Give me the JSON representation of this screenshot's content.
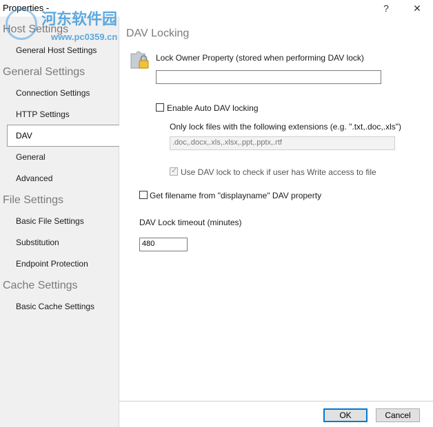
{
  "window": {
    "title": "Properties -",
    "help_glyph": "?",
    "close_glyph": "✕"
  },
  "watermark": {
    "cn": "河东软件园",
    "url": "www.pc0359.cn"
  },
  "sidebar": {
    "groups": [
      {
        "label": "Host Settings",
        "items": [
          "General Host Settings"
        ]
      },
      {
        "label": "General Settings",
        "items": [
          "Connection Settings",
          "HTTP Settings",
          "DAV",
          "General",
          "Advanced"
        ]
      },
      {
        "label": "File Settings",
        "items": [
          "Basic File Settings",
          "Substitution",
          "Endpoint Protection"
        ]
      },
      {
        "label": "Cache Settings",
        "items": [
          "Basic Cache Settings"
        ]
      }
    ],
    "selected": "DAV"
  },
  "main": {
    "section_title": "DAV Locking",
    "lock_owner_label": "Lock Owner Property (stored when performing DAV lock)",
    "lock_owner_value": "",
    "auto_lock_label": "Enable Auto DAV locking",
    "auto_lock_checked": false,
    "extensions_label": "Only lock files with the following extensions (e.g. \".txt,.doc,.xls\")",
    "extensions_value": ".doc,.docx,.xls,.xlsx,.ppt,.pptx,.rtf",
    "write_access_label": "Use DAV lock to check if user has Write access to file",
    "write_access_checked": true,
    "write_access_enabled": false,
    "displayname_label": "Get filename from \"displayname\" DAV property",
    "displayname_checked": false,
    "timeout_label": "DAV Lock timeout (minutes)",
    "timeout_value": "480"
  },
  "buttons": {
    "ok": "OK",
    "cancel": "Cancel"
  },
  "colors": {
    "accent": "#0078d7",
    "sidebar_bg": "#f0f0f0",
    "watermark": "#2a8fd8"
  }
}
